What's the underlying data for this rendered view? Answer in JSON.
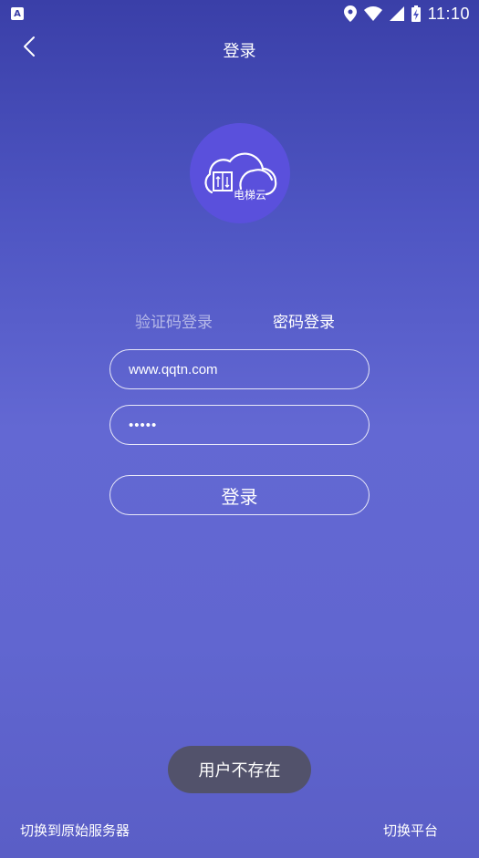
{
  "status_bar": {
    "notification_icon": "A",
    "time": "11:10",
    "icons": [
      "location-icon",
      "wifi-icon",
      "signal-icon",
      "battery-charging-icon"
    ]
  },
  "nav": {
    "title": "登录",
    "back_icon": "chevron-left-icon"
  },
  "logo": {
    "text": "电梯云",
    "icon": "cloud-elevator-icon",
    "color": "#5a50dc"
  },
  "tabs": {
    "sms_label": "验证码登录",
    "password_label": "密码登录",
    "active": "password"
  },
  "form": {
    "username_value": "www.qqtn.com",
    "password_value": "•••••"
  },
  "login_button": "登录",
  "toast": "用户不存在",
  "footer": {
    "switch_server": "切换到原始服务器",
    "switch_platform": "切换平台"
  },
  "colors": {
    "background_top": "#3a3fa8",
    "background_mid": "#6368d3",
    "toast_bg": "#50505a"
  }
}
